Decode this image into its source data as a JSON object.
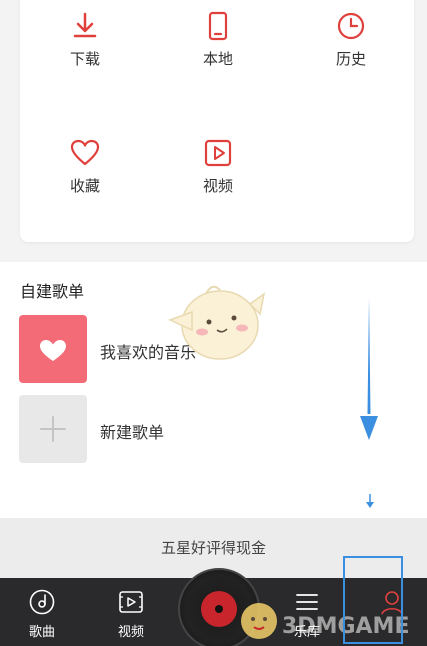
{
  "colors": {
    "accent": "#e0403c",
    "favorite_thumb": "#f26b77",
    "arrow": "#3b8fe0",
    "tabbar": "#2a2a2c"
  },
  "quick_access": [
    {
      "label": "下载",
      "icon": "download-icon"
    },
    {
      "label": "本地",
      "icon": "phone-icon"
    },
    {
      "label": "历史",
      "icon": "clock-icon"
    },
    {
      "label": "收藏",
      "icon": "heart-icon"
    },
    {
      "label": "视频",
      "icon": "video-play-icon"
    }
  ],
  "playlists": {
    "title": "自建歌单",
    "items": [
      {
        "name": "我喜欢的音乐",
        "icon": "heart-icon"
      },
      {
        "name": "新建歌单",
        "icon": "plus-icon"
      }
    ]
  },
  "promo": {
    "text": "五星好评得现金"
  },
  "tabbar": {
    "tabs": [
      {
        "label": "歌曲",
        "icon": "disc-icon"
      },
      {
        "label": "视频",
        "icon": "video-icon"
      },
      {
        "label": "",
        "icon": "vinyl-player-icon"
      },
      {
        "label": "乐库",
        "icon": "menu-icon"
      },
      {
        "label": "",
        "icon": "user-icon"
      }
    ]
  },
  "watermark": "3DMGAME"
}
